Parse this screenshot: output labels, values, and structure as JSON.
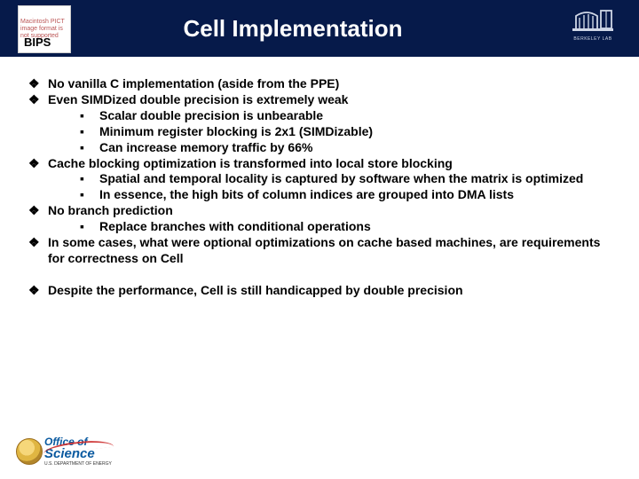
{
  "header": {
    "title": "Cell Implementation",
    "left_badge_label": "BIPS",
    "left_badge_hint": "Macintosh PICT\nimage format\nis not supported",
    "right_logo_label": "BERKELEY LAB"
  },
  "bullets": [
    {
      "text": "No vanilla C implementation (aside from the PPE)",
      "children": []
    },
    {
      "text": "Even SIMDized double precision is extremely weak",
      "children": [
        {
          "text": "Scalar double precision is unbearable"
        },
        {
          "text": "Minimum register blocking is 2x1 (SIMDizable)"
        },
        {
          "text": "Can increase memory traffic by 66%"
        }
      ]
    },
    {
      "text": "Cache blocking optimization is transformed into local store blocking",
      "children": [
        {
          "text": "Spatial and temporal locality is captured by software when the matrix is optimized"
        },
        {
          "text": "In essence, the high bits of column indices are grouped into DMA lists"
        }
      ]
    },
    {
      "text": "No branch prediction",
      "children": [
        {
          "text": "Replace branches with conditional operations"
        }
      ]
    },
    {
      "text": "In some cases, what were optional optimizations on cache based machines, are requirements for correctness on Cell",
      "children": []
    }
  ],
  "bullets2": [
    {
      "text": "Despite the performance, Cell is still handicapped by double precision",
      "children": []
    }
  ],
  "glyphs": {
    "lvl1": "❖",
    "lvl2": "▪"
  },
  "footer": {
    "line1": "Office of",
    "line2": "Science",
    "line3": "U.S. DEPARTMENT OF ENERGY"
  }
}
